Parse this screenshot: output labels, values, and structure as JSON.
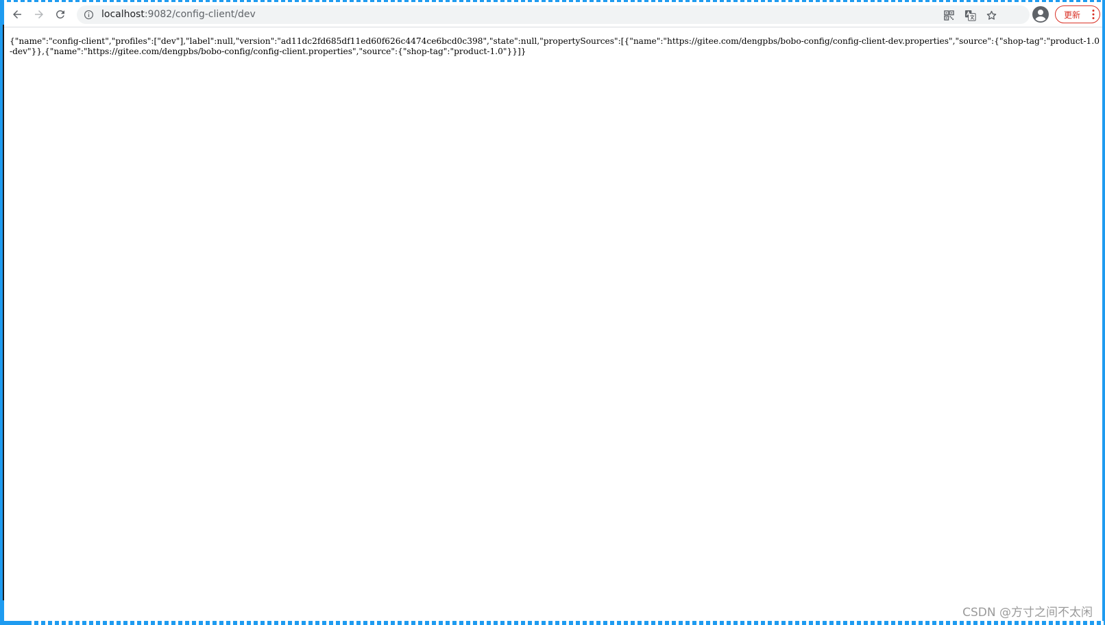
{
  "browser": {
    "url_host": "localhost",
    "url_path": ":9082/config-client/dev",
    "update_label": "更新",
    "icons": [
      "back-arrow-icon",
      "forward-arrow-icon",
      "reload-icon",
      "info-icon",
      "qr-code-icon",
      "translate-icon",
      "star-icon",
      "account-icon",
      "more-vert-icon"
    ]
  },
  "page": {
    "json_text": "{\"name\":\"config-client\",\"profiles\":[\"dev\"],\"label\":null,\"version\":\"ad11dc2fd685df11ed60f626c4474ce6bcd0c398\",\"state\":null,\"propertySources\":[{\"name\":\"https://gitee.com/dengpbs/bobo-config/config-client-dev.properties\",\"source\":{\"shop-tag\":\"product-1.0-dev\"}},{\"name\":\"https://gitee.com/dengpbs/bobo-config/config-client.properties\",\"source\":{\"shop-tag\":\"product-1.0\"}}]}"
  },
  "watermark": {
    "text": "CSDN @方寸之间不太闲"
  },
  "colors": {
    "accent": "#1e9bf0",
    "update_red": "#d93025",
    "omnibox_bg": "#f1f3f4"
  }
}
